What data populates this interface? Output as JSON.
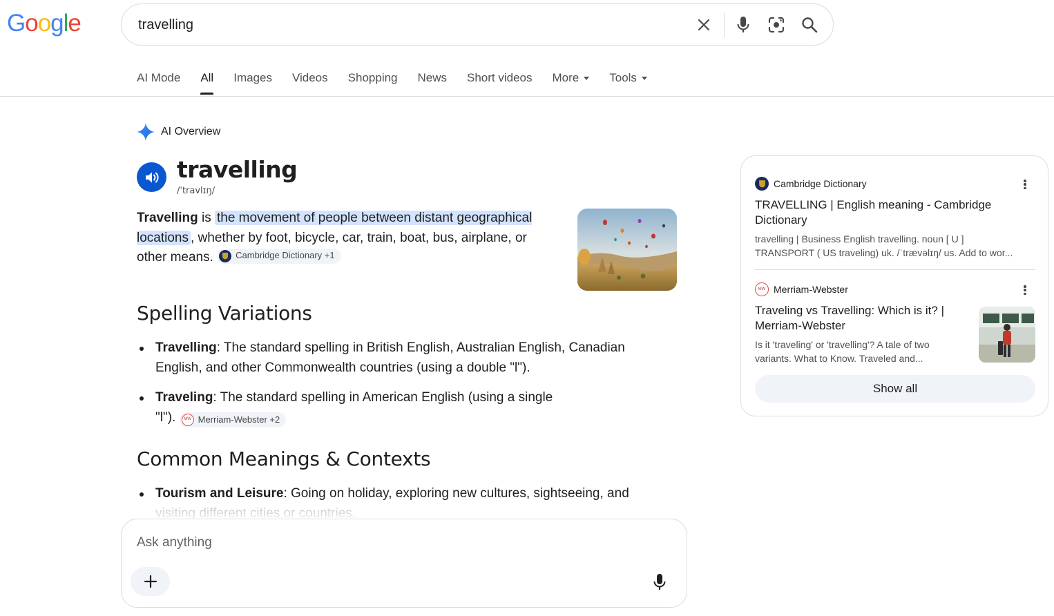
{
  "logo": {
    "letters": [
      "G",
      "o",
      "o",
      "g",
      "l",
      "e"
    ],
    "colors": [
      "#4285F4",
      "#EA4335",
      "#FBBC05",
      "#4285F4",
      "#34A853",
      "#EA4335"
    ]
  },
  "search": {
    "value": "travelling",
    "clear_icon": "close-icon",
    "voice_icon": "microphone-icon",
    "lens_icon": "camera-lens-icon",
    "search_icon": "search-icon"
  },
  "tabs": [
    {
      "label": "AI Mode"
    },
    {
      "label": "All",
      "active": true
    },
    {
      "label": "Images"
    },
    {
      "label": "Videos"
    },
    {
      "label": "Shopping"
    },
    {
      "label": "News"
    },
    {
      "label": "Short videos"
    },
    {
      "label": "More",
      "dropdown": true
    },
    {
      "label": "Tools",
      "dropdown": true
    }
  ],
  "ai_overview": {
    "heading": "AI Overview",
    "word": "travelling",
    "phonetic": "/ˈtravlɪŋ/",
    "definition": {
      "bold": "Travelling",
      "is": " is ",
      "highlight": "the movement of people between distant geographical locations",
      "rest": ", whether by foot, bicycle, car, train, boat, bus, airplane, or other means. ",
      "citation": "Cambridge Dictionary +1"
    },
    "sections": [
      {
        "title": "Spelling Variations",
        "items": [
          {
            "term": "Travelling",
            "text": ": The standard spelling in British English, Australian English, Canadian English, and other Commonwealth countries (using a double \"l\")."
          },
          {
            "term": "Traveling",
            "text": ": The standard spelling in American English (using a single \"l\"). ",
            "citation": "Merriam-Webster +2"
          }
        ]
      },
      {
        "title": "Common Meanings & Contexts",
        "items": [
          {
            "term": "Tourism and Leisure",
            "text": ": Going on holiday, exploring new cultures, sightseeing, and",
            "faded": "visiting different cities or countries."
          }
        ]
      }
    ]
  },
  "ask": {
    "placeholder": "Ask anything",
    "plus": "+"
  },
  "sources": [
    {
      "site": "Cambridge Dictionary",
      "title": "TRAVELLING | English meaning - Cambridge Dictionary",
      "snippet_1": "travelling | Business English travelling. noun [ U ]",
      "snippet_2": "TRANSPORT ( US traveling) uk. /ˈtrævəlɪŋ/ us. Add to wor..."
    },
    {
      "site": "Merriam-Webster",
      "title": "Traveling vs Travelling: Which is it? | Merriam-Webster",
      "snippet_1": "Is it 'traveling' or 'travelling'? A tale of two",
      "snippet_2": "variants. What to Know. Traveled and..."
    }
  ],
  "show_all": "Show all",
  "colors": {
    "accent": "#0b57d0",
    "highlight": "#d3e3fd",
    "chip_bg": "#f0f4f9",
    "border": "#dadce0"
  }
}
